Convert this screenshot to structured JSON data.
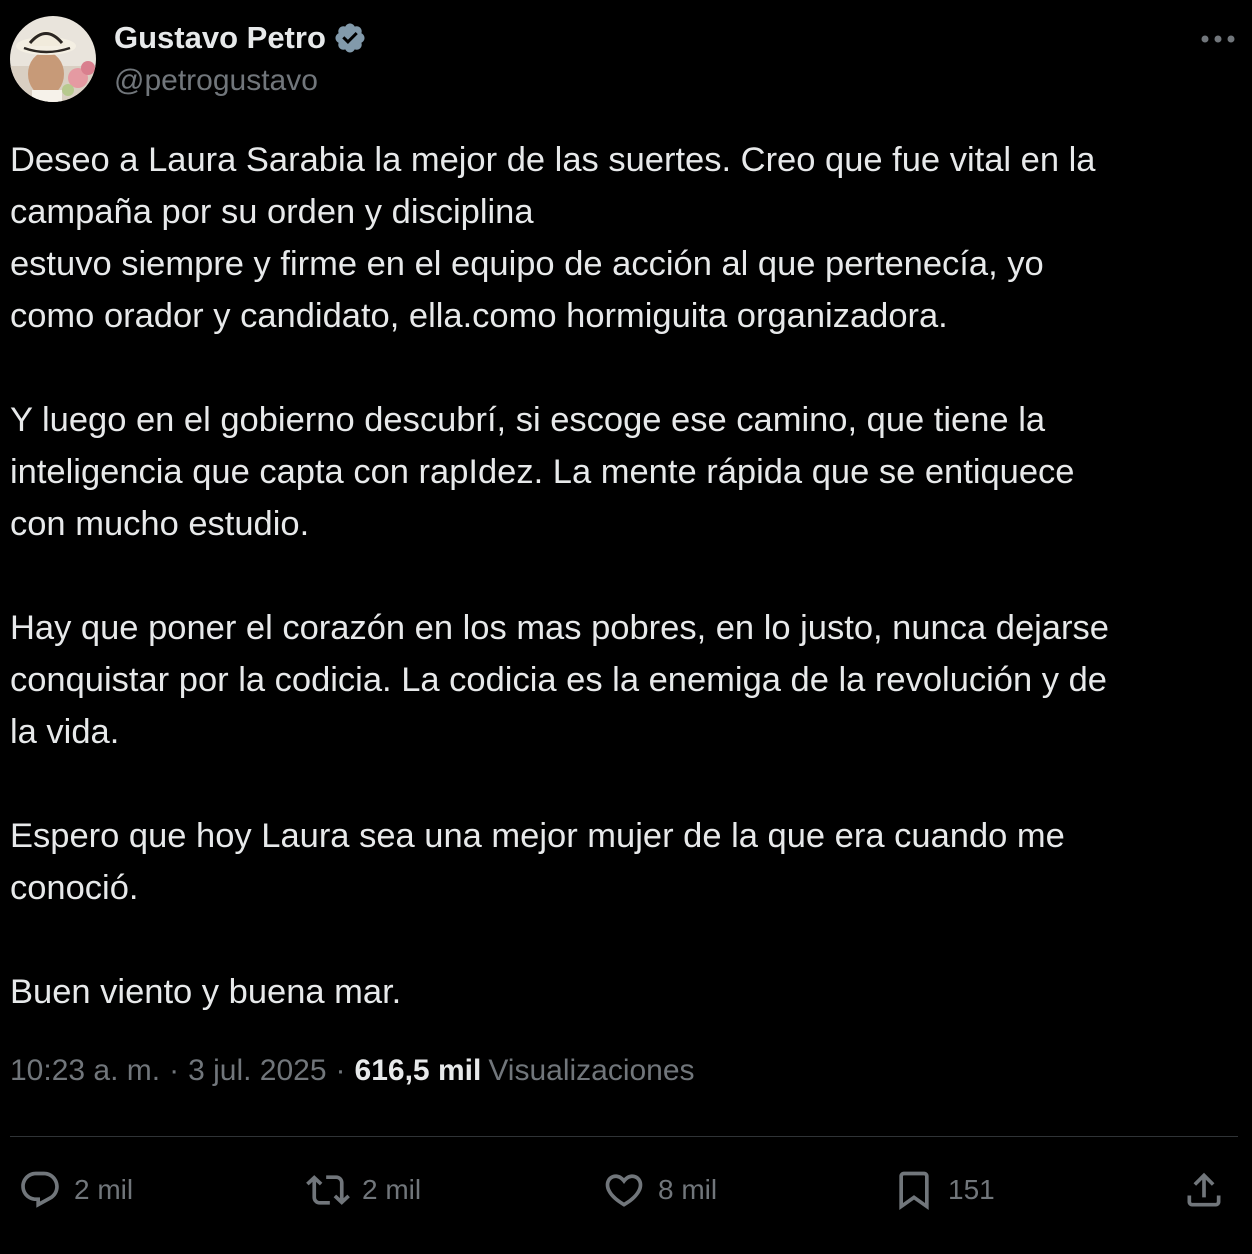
{
  "author": {
    "name": "Gustavo Petro",
    "handle": "@petrogustavo",
    "verified_icon": "verified-badge-icon"
  },
  "tweet": {
    "paragraphs": [
      [
        "Deseo a Laura Sarabia la mejor de las suertes. Creo que fue vital en la",
        "campaña por su orden y disciplina",
        "estuvo siempre y firme en el equipo de acción al que pertenecía, yo",
        "como orador y candidato, ella.como hormiguita organizadora."
      ],
      [
        "Y luego en el gobierno descubrí, si escoge ese camino, que tiene la",
        "inteligencia que capta con rapIdez. La mente rápida que se entiquece",
        "con mucho estudio."
      ],
      [
        "Hay que poner el corazón en los mas pobres, en lo justo, nunca dejarse",
        "conquistar por la codicia. La codicia es la enemiga de la revolución y de",
        "la vida."
      ],
      [
        "Espero que hoy Laura sea una mejor mujer de la que era cuando me",
        "conoció."
      ],
      [
        "Buen viento y buena mar."
      ]
    ]
  },
  "meta": {
    "time": "10:23 a. m.",
    "separator": "·",
    "date": "3 jul. 2025",
    "views_count": "616,5 mil",
    "views_label": "Visualizaciones"
  },
  "actions": {
    "replies": "2 mil",
    "reposts": "2 mil",
    "likes": "8 mil",
    "bookmarks": "151"
  },
  "colors": {
    "background": "#000000",
    "text": "#e7e9ea",
    "secondary": "#71767b",
    "divider": "#2f3336",
    "verified": "#829aab"
  }
}
